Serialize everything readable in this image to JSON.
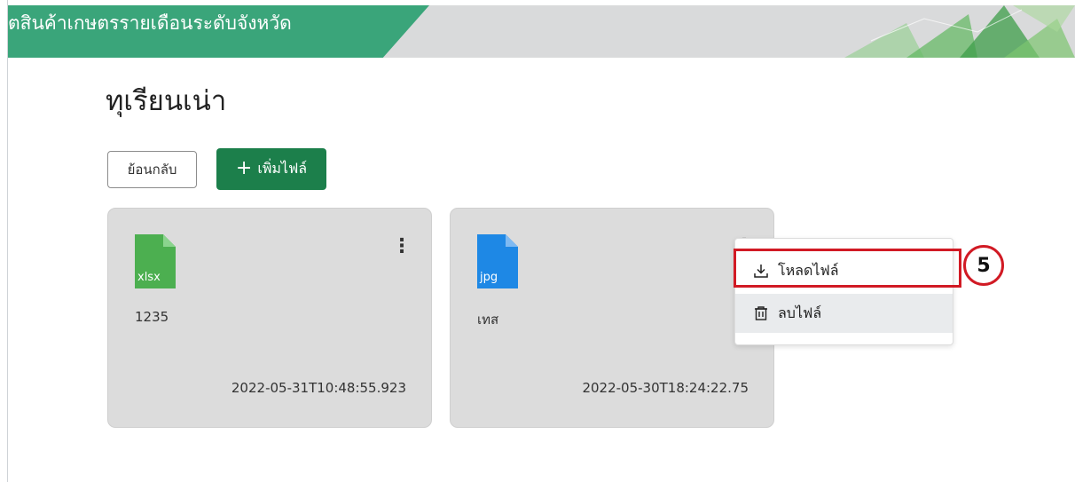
{
  "header": {
    "title": "ิตสินค้าเกษตรรายเดือนระดับจังหวัด"
  },
  "page": {
    "title": "ทุเรียนเน่า"
  },
  "actions": {
    "back_label": "ย้อนกลับ",
    "add_icon": "+",
    "add_label": "เพิ่มไฟล์"
  },
  "files": [
    {
      "ext": "xlsx",
      "name": "1235",
      "date": "2022-05-31T10:48:55.923",
      "icon_color": "#4caf50",
      "icon": "spreadsheet-file-icon"
    },
    {
      "ext": "jpg",
      "name": "เทส",
      "date": "2022-05-30T18:24:22.75",
      "icon_color": "#1e88e5",
      "icon": "image-file-icon"
    }
  ],
  "menu": {
    "download_label": "โหลดไฟล์",
    "delete_label": "ลบไฟล์"
  },
  "annotation": {
    "step": "5",
    "color": "#d11a24"
  },
  "colors": {
    "brand_green": "#3aa57a",
    "button_green": "#1c7f4b"
  }
}
